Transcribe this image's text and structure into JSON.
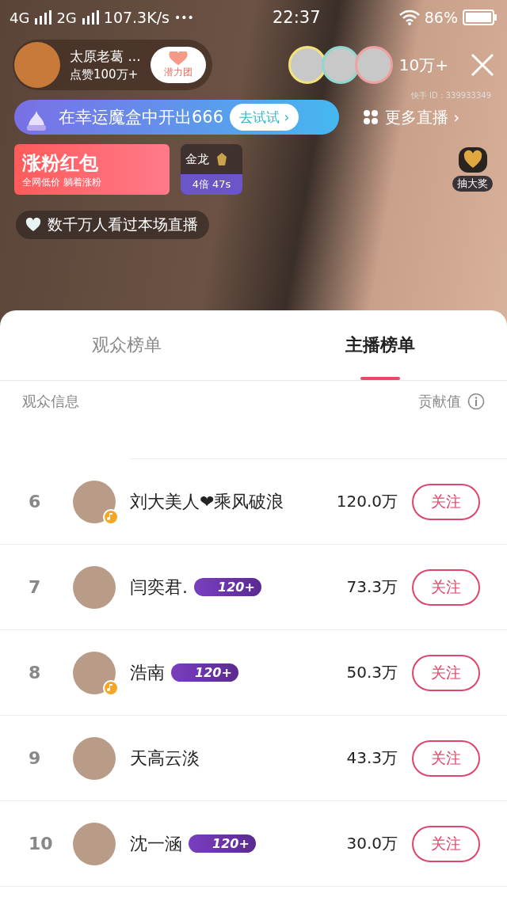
{
  "status_bar": {
    "network_1": "4G",
    "network_2": "2G",
    "speed": "107.3K/s",
    "more": "•••",
    "time": "22:37",
    "battery": "86%"
  },
  "streamer": {
    "name": "太原老葛 ...",
    "likes": "点赞100万+",
    "group_badge": "潜力团"
  },
  "viewers": {
    "count": "10万+"
  },
  "user_id": "快手 ID：339933349",
  "banner": {
    "text": "在幸运魔盒中开出666",
    "button": "去试试 ›"
  },
  "more_live": "更多直播 ›",
  "red_packet": {
    "title": "涨粉红包",
    "subtitle": "全网低价 躺着涨粉"
  },
  "dragon": {
    "title": "金龙",
    "timer": "4倍 47s"
  },
  "lottery": "抽大奖",
  "watched": "数千万人看过本场直播",
  "tabs": [
    {
      "label": "观众榜单",
      "selected": false
    },
    {
      "label": "主播榜单",
      "selected": true
    }
  ],
  "header": {
    "left": "观众信息",
    "right": "贡献值"
  },
  "rows": [
    {
      "rank": "6",
      "name": "刘大美人❤乘风破浪",
      "music_badge": true,
      "value": "120.0万",
      "follow": "关注"
    },
    {
      "rank": "7",
      "name": "闫奕君.",
      "music_badge": false,
      "level": "120+",
      "value": "73.3万",
      "follow": "关注"
    },
    {
      "rank": "8",
      "name": "浩南",
      "music_badge": true,
      "level": "120+",
      "value": "50.3万",
      "follow": "关注"
    },
    {
      "rank": "9",
      "name": "天高云淡",
      "music_badge": false,
      "value": "43.3万",
      "follow": "关注"
    },
    {
      "rank": "10",
      "name": "沈一涵",
      "music_badge": false,
      "level": "120+",
      "value": "30.0万",
      "follow": "关注"
    }
  ]
}
